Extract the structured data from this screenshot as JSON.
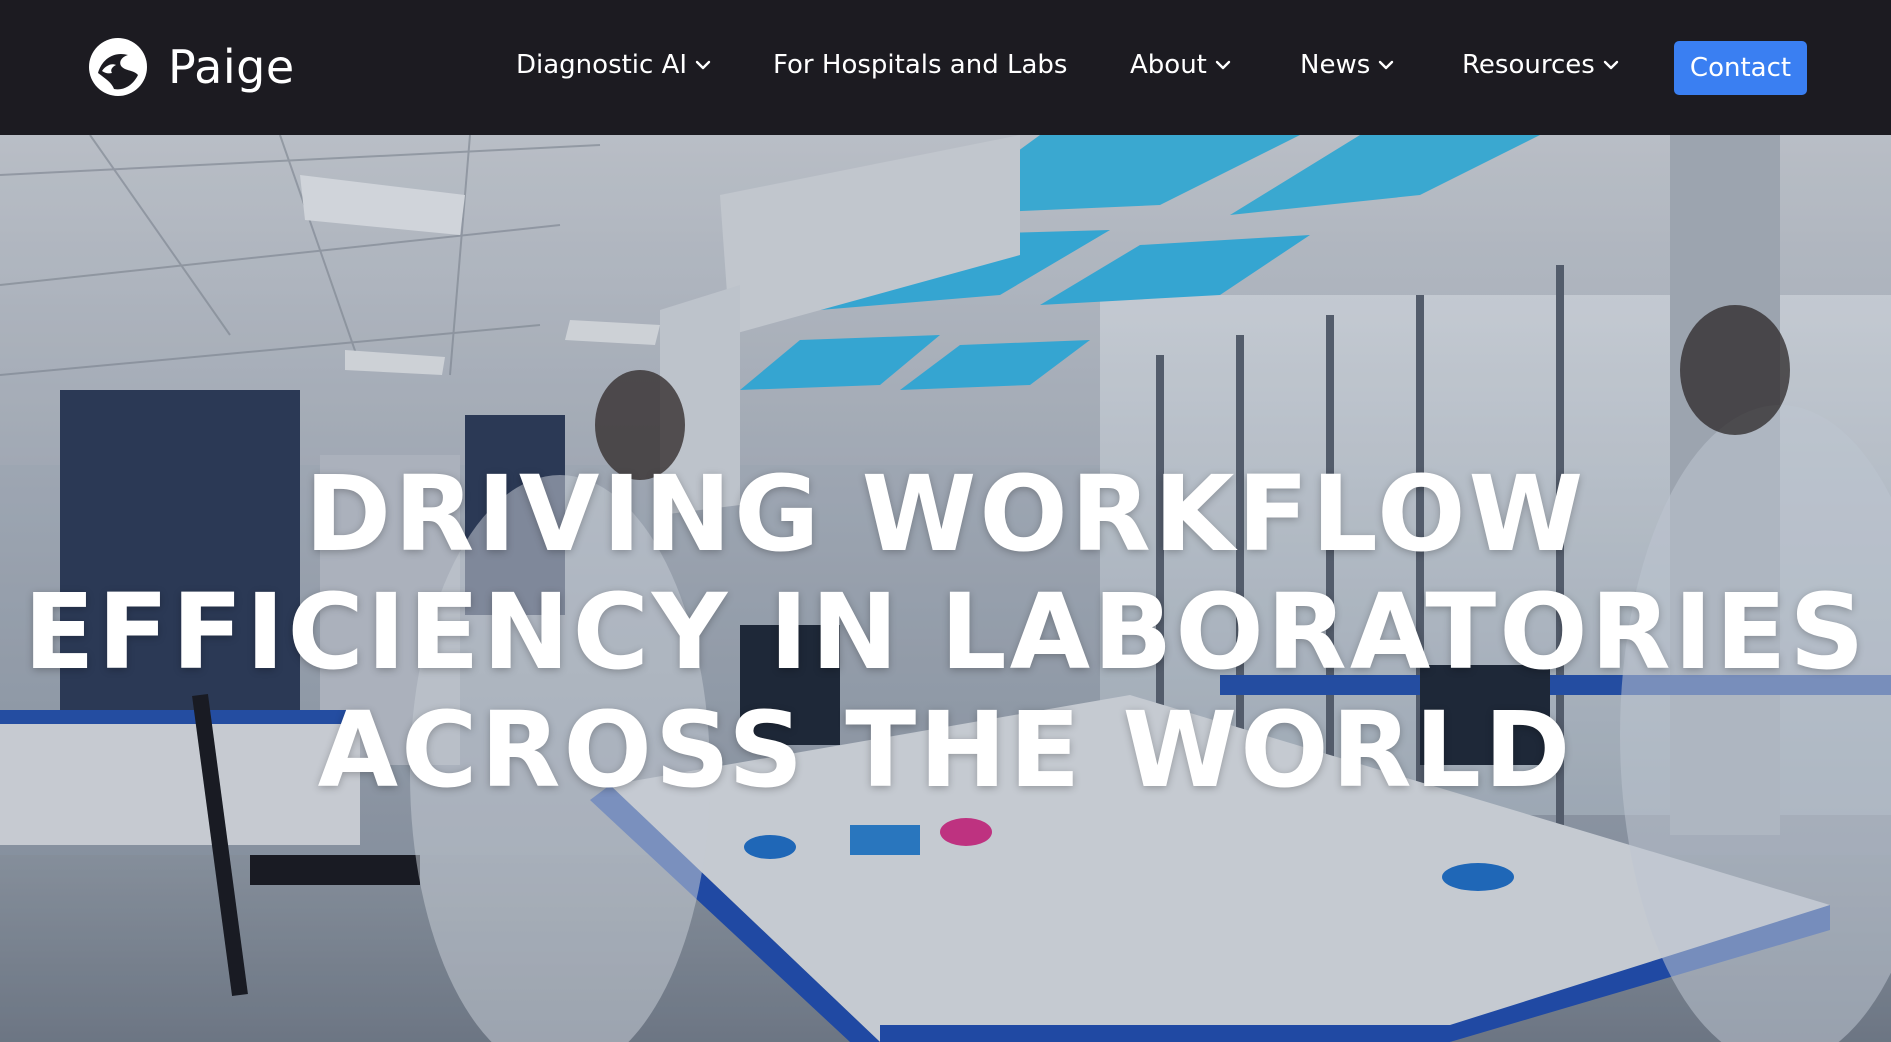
{
  "brand": {
    "name": "Paige",
    "logo_icon": "paige-head-logo-icon"
  },
  "nav": {
    "items": [
      {
        "label": "Diagnostic AI",
        "has_dropdown": true
      },
      {
        "label": "For Hospitals and Labs",
        "has_dropdown": false
      },
      {
        "label": "About",
        "has_dropdown": true
      },
      {
        "label": "News",
        "has_dropdown": true
      },
      {
        "label": "Resources",
        "has_dropdown": true
      }
    ],
    "contact_label": "Contact",
    "dropdown_icon": "chevron-down-icon"
  },
  "hero": {
    "headline_lines": [
      "DRIVING WORKFLOW",
      "EFFICIENCY IN LABORATORIES",
      "ACROSS THE WORLD"
    ],
    "background": "laboratory-scene-image"
  },
  "colors": {
    "nav_bg": "#1c1b21",
    "contact_bg": "#3a7ff2",
    "text": "#ffffff",
    "bench_blue": "#1f4fb8",
    "light_panel": "#39c3f0"
  }
}
